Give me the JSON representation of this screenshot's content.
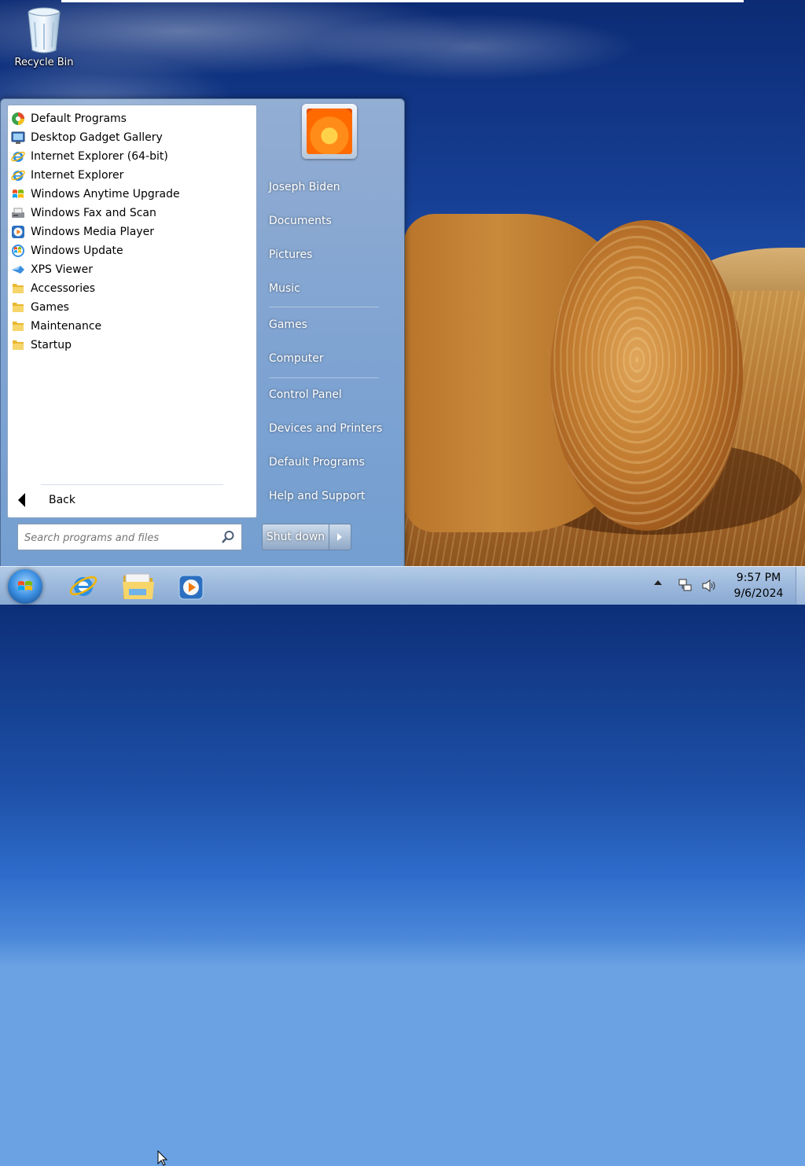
{
  "desktop": {
    "recycle_bin_label": "Recycle Bin",
    "wallpaper": "hay-bale-field"
  },
  "start_menu": {
    "programs": [
      {
        "label": "Default Programs",
        "icon": "default-programs-icon"
      },
      {
        "label": "Desktop Gadget Gallery",
        "icon": "gadget-gallery-icon"
      },
      {
        "label": "Internet Explorer (64-bit)",
        "icon": "internet-explorer-icon"
      },
      {
        "label": "Internet Explorer",
        "icon": "internet-explorer-icon"
      },
      {
        "label": "Windows Anytime Upgrade",
        "icon": "windows-flag-icon"
      },
      {
        "label": "Windows Fax and Scan",
        "icon": "fax-icon"
      },
      {
        "label": "Windows Media Player",
        "icon": "media-player-icon"
      },
      {
        "label": "Windows Update",
        "icon": "windows-update-icon"
      },
      {
        "label": "XPS Viewer",
        "icon": "xps-viewer-icon"
      },
      {
        "label": "Accessories",
        "icon": "folder-icon"
      },
      {
        "label": "Games",
        "icon": "folder-icon"
      },
      {
        "label": "Maintenance",
        "icon": "folder-icon"
      },
      {
        "label": "Startup",
        "icon": "folder-icon"
      }
    ],
    "back_label": "Back",
    "search_placeholder": "Search programs and files",
    "user_name": "Joseph Biden",
    "right_items": [
      "Documents",
      "Pictures",
      "Music",
      "Games",
      "Computer",
      "Control Panel",
      "Devices and Printers",
      "Default Programs",
      "Help and Support"
    ],
    "shutdown_label": "Shut down"
  },
  "taskbar": {
    "pinned": [
      "internet-explorer-icon",
      "file-explorer-icon",
      "media-player-icon"
    ],
    "tray": {
      "time": "9:57 PM",
      "date": "9/6/2024",
      "icons": [
        "network-icon",
        "volume-icon"
      ]
    }
  },
  "colors": {
    "taskbar": "#9cb8dc",
    "start_menu_left": "#ffffff",
    "accent": "#3a8ee0"
  }
}
